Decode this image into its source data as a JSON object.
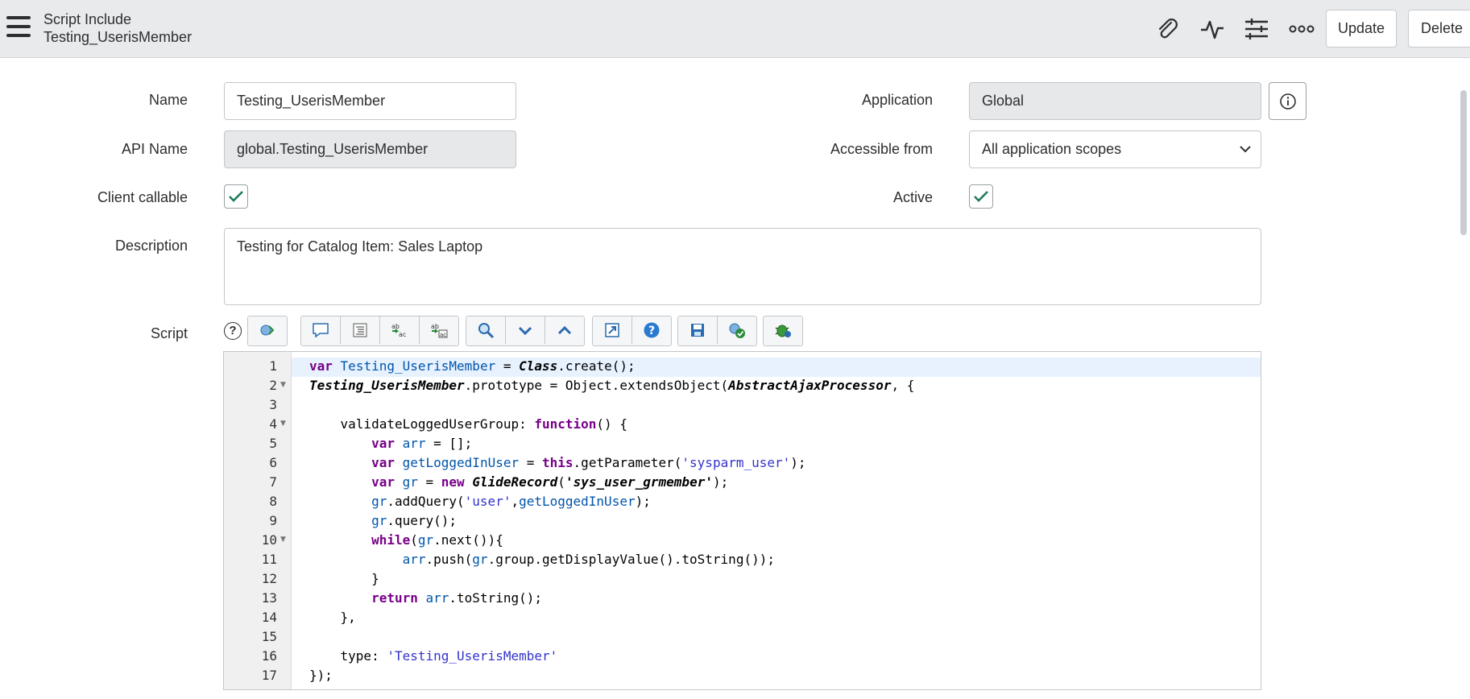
{
  "header": {
    "title": "Script Include",
    "subtitle": "Testing_UserisMember",
    "update_label": "Update",
    "delete_label": "Delete",
    "icons": [
      "attachment-icon",
      "activity-icon",
      "settings-sliders-icon",
      "more-options-icon"
    ]
  },
  "form": {
    "name_label": "Name",
    "name_value": "Testing_UserisMember",
    "api_name_label": "API Name",
    "api_name_value": "global.Testing_UserisMember",
    "client_callable_label": "Client callable",
    "client_callable": true,
    "description_label": "Description",
    "description_value": "Testing for Catalog Item: Sales Laptop",
    "application_label": "Application",
    "application_value": "Global",
    "accessible_from_label": "Accessible from",
    "accessible_from_value": "All application scopes",
    "active_label": "Active",
    "active": true,
    "script_label": "Script"
  },
  "colors": {
    "check": "#1f7a5c",
    "keyword": "#770088",
    "variable": "#0055aa",
    "string": "#aa1111"
  },
  "script": {
    "line_numbers": [
      "1",
      "2",
      "3",
      "4",
      "5",
      "6",
      "7",
      "8",
      "9",
      "10",
      "11",
      "12",
      "13",
      "14",
      "15",
      "16",
      "17"
    ],
    "lines": [
      "var Testing_UserisMember = Class.create();",
      "Testing_UserisMember.prototype = Object.extendsObject(AbstractAjaxProcessor, {",
      "",
      "    validateLoggedUserGroup: function() {",
      "        var arr = [];",
      "        var getLoggedInUser = this.getParameter('sysparm_user');",
      "        var gr = new GlideRecord('sys_user_grmember');",
      "        gr.addQuery('user',getLoggedInUser);",
      "        gr.query();",
      "        while(gr.next()){",
      "            arr.push(gr.group.getDisplayValue().toString());",
      "        }",
      "        return arr.toString();",
      "    },",
      "",
      "    type: 'Testing_UserisMember'",
      "});"
    ]
  }
}
